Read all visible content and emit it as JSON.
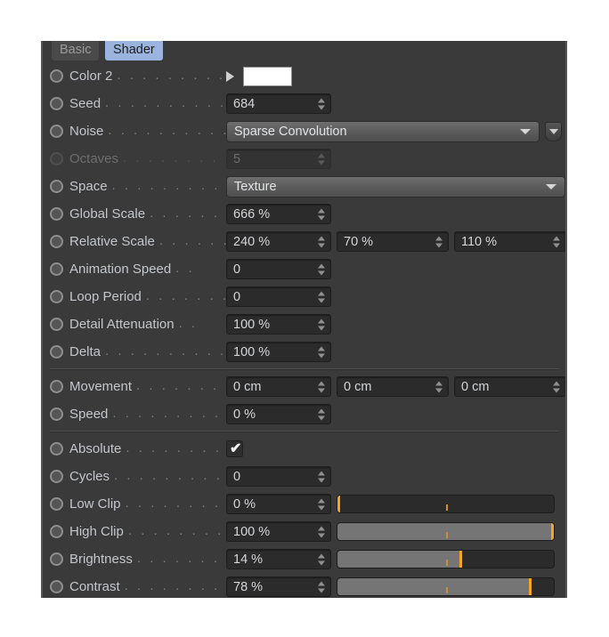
{
  "tabs": [
    {
      "label": "Basic",
      "active": false
    },
    {
      "label": "Shader",
      "active": true
    }
  ],
  "colors": {
    "accent_selected_tab": "#9bb4dd",
    "slider_knob_orange": "#f5a623",
    "slider_fill_gray": "#757575",
    "panel_background": "#3a3a3a",
    "field_background": "#2b2b2b",
    "color2_swatch": "#ffffff"
  },
  "groups": [
    {
      "rows": [
        {
          "label": "Color 2",
          "leader": ". . . . . . . . .",
          "type": "color",
          "value": "#ffffff",
          "disabled": false
        },
        {
          "label": "Seed",
          "leader": ". . . . . . . . . . . .",
          "type": "number",
          "value": "684",
          "disabled": false
        },
        {
          "label": "Noise",
          "leader": ". . . . . . . . . . .",
          "type": "combo-extra",
          "value": "Sparse Convolution",
          "disabled": false
        },
        {
          "label": "Octaves",
          "leader": ". . . . . . . . . .",
          "type": "number",
          "value": "5",
          "disabled": true
        },
        {
          "label": "Space",
          "leader": ". . . . . . . . . . .",
          "type": "combo-wide",
          "value": "Texture",
          "disabled": false
        },
        {
          "label": "Global Scale",
          "leader": ". . . . . . .",
          "type": "number",
          "value": "666 %",
          "disabled": false
        },
        {
          "label": "Relative Scale",
          "leader": ". . . . . .",
          "type": "number3",
          "value": "240 %",
          "value2": "70 %",
          "value3": "110 %",
          "disabled": false
        },
        {
          "label": "Animation Speed",
          "leader": ". .",
          "type": "number",
          "value": "0",
          "disabled": false
        },
        {
          "label": "Loop Period",
          "leader": ". . . . . . . .",
          "type": "number",
          "value": "0",
          "disabled": false
        },
        {
          "label": "Detail Attenuation",
          "leader": ". .",
          "type": "number",
          "value": "100 %",
          "disabled": false
        },
        {
          "label": "Delta",
          "leader": ". . . . . . . . . . . .",
          "type": "number",
          "value": "100 %",
          "disabled": false
        }
      ]
    },
    {
      "rows": [
        {
          "label": "Movement",
          "leader": ". . . . . . . . .",
          "type": "number3",
          "value": "0 cm",
          "value2": "0 cm",
          "value3": "0 cm",
          "disabled": false
        },
        {
          "label": "Speed",
          "leader": ". . . . . . . . . . . .",
          "type": "number",
          "value": "0 %",
          "disabled": false
        }
      ]
    },
    {
      "rows": [
        {
          "label": "Absolute",
          "leader": ". . . . . . . . . .",
          "type": "checkbox",
          "value": "✔",
          "checked": true,
          "disabled": false
        },
        {
          "label": "Cycles",
          "leader": ". . . . . . . . . . . .",
          "type": "number",
          "value": "0",
          "disabled": false
        },
        {
          "label": "Low Clip",
          "leader": ". . . . . . . . . .",
          "type": "slider",
          "value": "0 %",
          "fill_pct": 0,
          "knob_pct": 0,
          "mid_pct": 50,
          "disabled": false
        },
        {
          "label": "High Clip",
          "leader": ". . . . . . . . .",
          "type": "slider",
          "value": "100 %",
          "fill_pct": 100,
          "knob_pct": 100,
          "mid_pct": 50,
          "disabled": false
        },
        {
          "label": "Brightness",
          "leader": ". . . . . . . .",
          "type": "slider",
          "value": "14 %",
          "fill_pct": 57,
          "knob_pct": 57,
          "mid_pct": 50,
          "disabled": false
        },
        {
          "label": "Contrast",
          "leader": ". . . . . . . . . .",
          "type": "slider",
          "value": "78 %",
          "fill_pct": 89,
          "knob_pct": 89,
          "mid_pct": 50,
          "disabled": false
        }
      ]
    }
  ]
}
